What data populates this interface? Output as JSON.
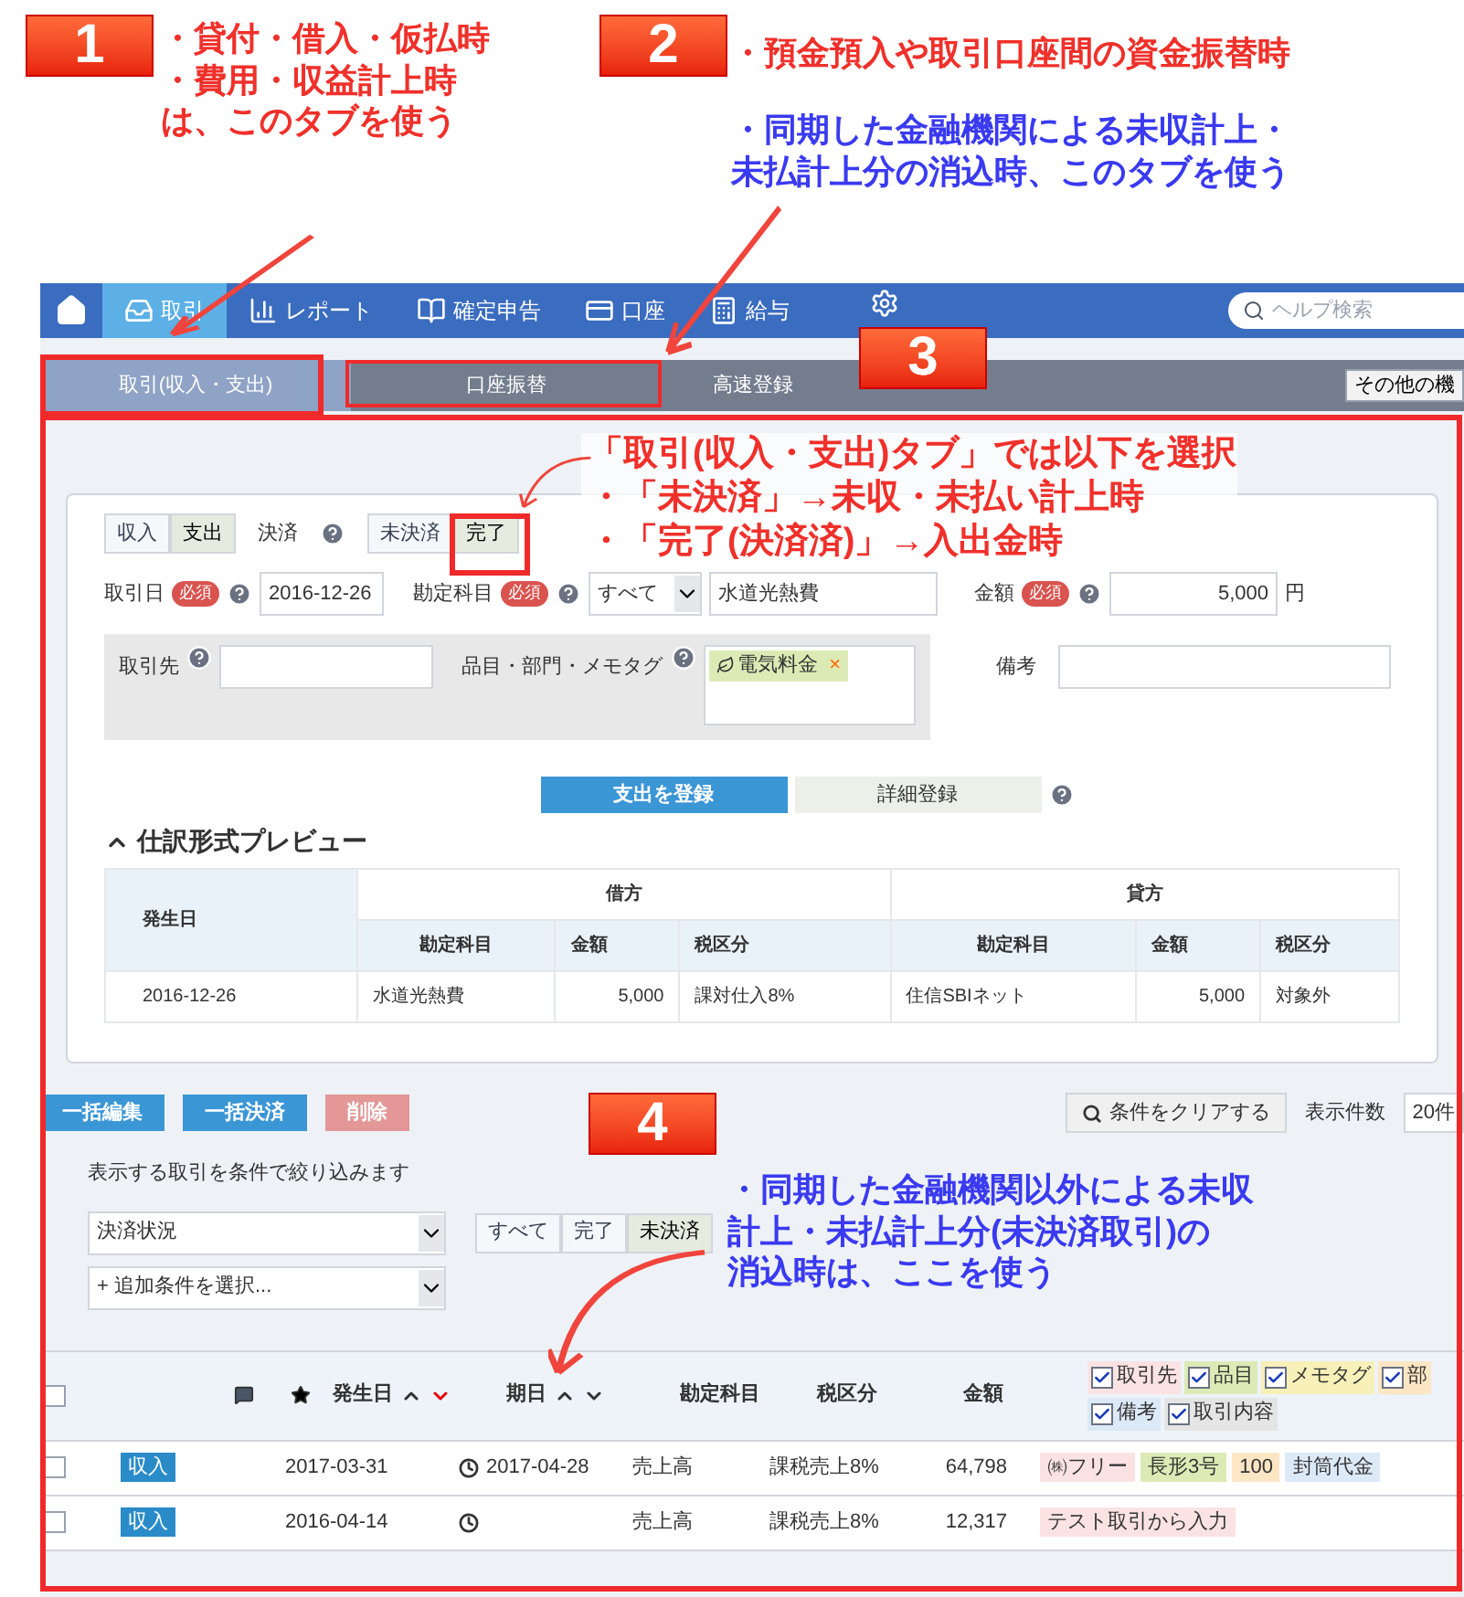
{
  "annotations": [
    {
      "kind": "callout",
      "number": "1",
      "lines": [
        "・貸付・借入・仮払時",
        "・費用・収益計上時",
        "は、このタブを使う"
      ]
    },
    {
      "kind": "callout",
      "number": "2",
      "lines": [
        "・預金預入や取引口座間の資金振替時"
      ],
      "note": [
        "・同期した金融機関による未収計上・",
        "未払計上分の消込時、このタブを使う"
      ]
    },
    {
      "kind": "badge",
      "number": "3"
    },
    {
      "kind": "note",
      "lines": [
        "「取引(収入・支出)タブ」では以下を選択",
        "・「未決済」→未収・未払い計上時",
        "・「完了(決済済)」→入出金時"
      ]
    },
    {
      "kind": "callout",
      "number": "4",
      "lines": [
        "・同期した金融機関以外による未収",
        "計上・未払計上分(未決済取引)の",
        "消込時は、ここを使う"
      ]
    }
  ],
  "nav": {
    "items": [
      {
        "label": "取引",
        "selected": true
      },
      {
        "label": "レポート",
        "selected": false
      },
      {
        "label": "確定申告",
        "selected": false
      },
      {
        "label": "口座",
        "selected": false
      },
      {
        "label": "給与",
        "selected": false
      }
    ],
    "search": {
      "placeholder": "ヘルプ検索"
    }
  },
  "tabs": [
    {
      "label": "取引(収入・支出)",
      "selected": true
    },
    {
      "label": "口座振替",
      "selected": false
    },
    {
      "label": "高速登録",
      "selected": false
    }
  ],
  "other_button": "その他の機",
  "form": {
    "type_toggle": [
      {
        "label": "収入",
        "selected": false
      },
      {
        "label": "支出",
        "selected": true
      }
    ],
    "settlement_label": "決済",
    "settlement_toggle": [
      {
        "label": "未決済",
        "selected": false
      },
      {
        "label": "完了",
        "selected": true
      }
    ],
    "date": {
      "label": "取引日",
      "required": "必須",
      "value": "2016-12-26"
    },
    "account": {
      "label": "勘定科目",
      "required": "必須",
      "select": "すべて",
      "value": "水道光熱費"
    },
    "amount": {
      "label": "金額",
      "required": "必須",
      "value": "5,000",
      "unit": "円"
    },
    "partner": {
      "label": "取引先"
    },
    "tags": {
      "label": "品目・部門・メモタグ",
      "items": [
        "電気料金"
      ],
      "remove": "×"
    },
    "memo": {
      "label": "備考"
    },
    "submit": "支出を登録",
    "detail": "詳細登録"
  },
  "preview": {
    "title": "仕訳形式プレビュー",
    "groups": [
      "借方",
      "貸方"
    ],
    "columns": [
      "発生日",
      "勘定科目",
      "金額",
      "税区分",
      "勘定科目",
      "金額",
      "税区分"
    ],
    "rows": [
      [
        "2016-12-26",
        "水道光熱費",
        "5,000",
        "課対仕入8%",
        "住信SBIネット",
        "5,000",
        "対象外"
      ]
    ]
  },
  "bulk_buttons": [
    {
      "label": "一括編集",
      "disabled": false
    },
    {
      "label": "一括決済",
      "disabled": false
    },
    {
      "label": "削除",
      "disabled": true
    }
  ],
  "clear_button": "条件をクリアする",
  "per_page": {
    "label": "表示件数",
    "value": "20件"
  },
  "filter": {
    "caption": "表示する取引を条件で絞り込みます",
    "select": "決済状況",
    "status": [
      {
        "label": "すべて",
        "selected": false
      },
      {
        "label": "完了",
        "selected": false
      },
      {
        "label": "未決済",
        "selected": true
      }
    ],
    "add": "+ 追加条件を選択..."
  },
  "list": {
    "select_all_checked": false,
    "columns": [
      "発生日",
      "期日",
      "勘定科目",
      "税区分",
      "金額"
    ],
    "toggles": [
      {
        "label": "取引先",
        "checked": true,
        "color": "#fbe3e3"
      },
      {
        "label": "品目",
        "checked": true,
        "color": "#dcebb5"
      },
      {
        "label": "メモタグ",
        "checked": true,
        "color": "#f7f0b8"
      },
      {
        "label": "部",
        "checked": true,
        "color": "#fde6c4"
      },
      {
        "label": "備考",
        "checked": true,
        "color": "#dce9f7"
      },
      {
        "label": "取引内容",
        "checked": true,
        "color": "#e5e5e5"
      }
    ],
    "rows": [
      {
        "checked": false,
        "type": "収入",
        "date": "2017-03-31",
        "due": "2017-04-28",
        "account": "売上高",
        "tax": "課税売上8%",
        "amount": "64,798",
        "tags": [
          {
            "text": "㈱フリー",
            "color": "#fbe3e3"
          },
          {
            "text": "長形3号",
            "color": "#dcebb5"
          },
          {
            "text": "100",
            "color": "#fde6c4"
          },
          {
            "text": "封筒代金",
            "color": "#dce9f7"
          }
        ]
      },
      {
        "checked": false,
        "type": "収入",
        "date": "2016-04-14",
        "due": "",
        "account": "売上高",
        "tax": "課税売上8%",
        "amount": "12,317",
        "tags": [
          {
            "text": "テスト取引から入力",
            "color": "#fbe3e3"
          }
        ]
      }
    ]
  }
}
